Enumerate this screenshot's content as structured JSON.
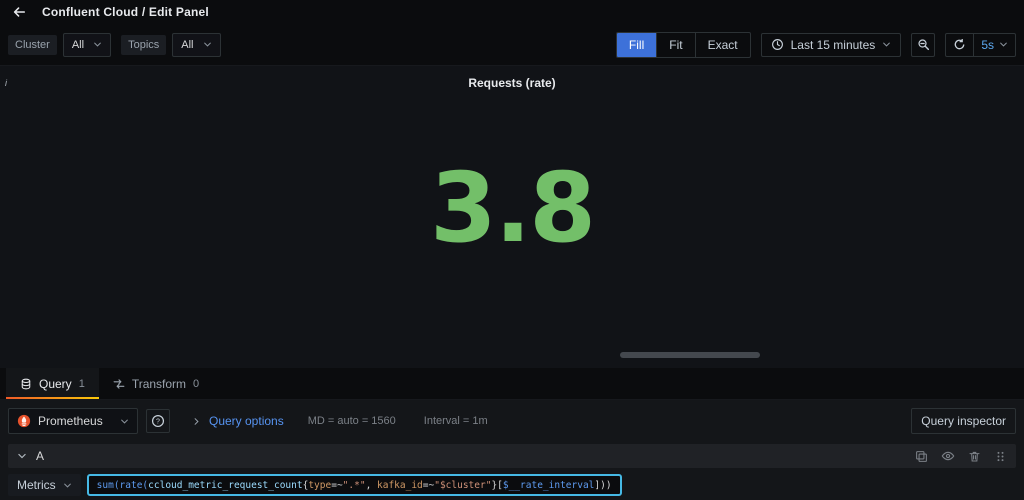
{
  "header": {
    "title": "Confluent Cloud / Edit Panel"
  },
  "toolbar": {
    "variables": [
      {
        "label": "Cluster",
        "value": "All"
      },
      {
        "label": "Topics",
        "value": "All"
      }
    ],
    "view_modes": {
      "fill": "Fill",
      "fit": "Fit",
      "exact": "Exact"
    },
    "time_range": "Last 15 minutes",
    "refresh_interval": "5s"
  },
  "panel": {
    "info_glyph": "i",
    "title": "Requests (rate)",
    "value": "3.8",
    "value_color": "#73bf69"
  },
  "tabs": {
    "query": {
      "label": "Query",
      "count": "1"
    },
    "transform": {
      "label": "Transform",
      "count": "0"
    }
  },
  "editor": {
    "datasource": "Prometheus",
    "query_options_label": "Query options",
    "options_md": "MD = auto = 1560",
    "options_interval": "Interval = 1m",
    "query_inspector_label": "Query inspector",
    "row_label": "A",
    "metrics_label": "Metrics",
    "query": {
      "full_text": "sum(rate(ccloud_metric_request_count{type=~\".*\", kafka_id=~\"$cluster\"}[$__rate_interval]))",
      "segments": [
        {
          "text": "sum(rate(",
          "type": "fn"
        },
        {
          "text": "ccloud_metric_request_count",
          "type": "metric"
        },
        {
          "text": "{",
          "type": "punct"
        },
        {
          "text": "type",
          "type": "label"
        },
        {
          "text": "=~",
          "type": "op"
        },
        {
          "text": "\".*\"",
          "type": "str"
        },
        {
          "text": ", ",
          "type": "punct"
        },
        {
          "text": "kafka_id",
          "type": "label"
        },
        {
          "text": "=~",
          "type": "op"
        },
        {
          "text": "\"$cluster\"",
          "type": "str"
        },
        {
          "text": "}[",
          "type": "punct"
        },
        {
          "text": "$__rate_interval",
          "type": "var"
        },
        {
          "text": "]))",
          "type": "punct"
        }
      ]
    }
  },
  "colors": {
    "accent_blue": "#3d71d9",
    "stat_green": "#73bf69",
    "focus_cyan": "#46b9e5",
    "link_blue": "#5794f2",
    "prometheus_orange": "#e6522c"
  }
}
